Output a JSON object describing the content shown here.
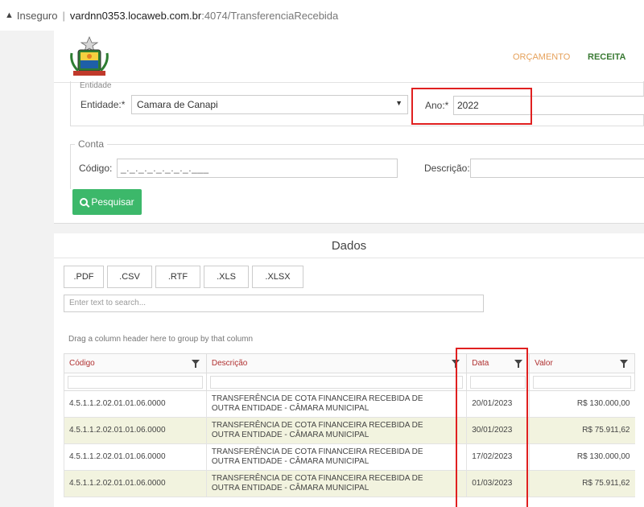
{
  "browser": {
    "security_label": "Inseguro",
    "url_host": "vardnn0353.locaweb.com.br",
    "url_path": ":4074/TransferenciaRecebida"
  },
  "header": {
    "nav": [
      {
        "label": "ORÇAMENTO"
      },
      {
        "label": "RECEITA"
      }
    ]
  },
  "filters": {
    "entidade_legend": "Entidade",
    "entidade_label": "Entidade:*",
    "entidade_value": "Camara de Canapi",
    "ano_label": "Ano:*",
    "ano_value": "2022",
    "conta_legend": "Conta",
    "codigo_label": "Código:",
    "codigo_mask": "_._._._._._._._.___",
    "descricao_label": "Descrição:",
    "search_button": "Pesquisar"
  },
  "data_panel": {
    "title": "Dados",
    "export_buttons": [
      ".PDF",
      ".CSV",
      ".RTF",
      ".XLS",
      ".XLSX"
    ],
    "search_placeholder": "Enter text to search...",
    "group_hint": "Drag a column header here to group by that column",
    "columns": [
      "Código",
      "Descrição",
      "Data",
      "Valor"
    ],
    "rows": [
      {
        "codigo": "4.5.1.1.2.02.01.01.06.0000",
        "descricao_1": "TRANSFERÊNCIA DE COTA FINANCEIRA RECEBIDA DE",
        "descricao_2": "OUTRA ENTIDADE - CÂMARA MUNICIPAL",
        "data": "20/01/2023",
        "valor": "R$ 130.000,00"
      },
      {
        "codigo": "4.5.1.1.2.02.01.01.06.0000",
        "descricao_1": "TRANSFERÊNCIA DE COTA FINANCEIRA RECEBIDA DE",
        "descricao_2": "OUTRA ENTIDADE - CÂMARA MUNICIPAL",
        "data": "30/01/2023",
        "valor": "R$ 75.911,62"
      },
      {
        "codigo": "4.5.1.1.2.02.01.01.06.0000",
        "descricao_1": "TRANSFERÊNCIA DE COTA FINANCEIRA RECEBIDA DE",
        "descricao_2": "OUTRA ENTIDADE - CÂMARA MUNICIPAL",
        "data": "17/02/2023",
        "valor": "R$ 130.000,00"
      },
      {
        "codigo": "4.5.1.1.2.02.01.01.06.0000",
        "descricao_1": "TRANSFERÊNCIA DE COTA FINANCEIRA RECEBIDA DE",
        "descricao_2": "OUTRA ENTIDADE - CÂMARA MUNICIPAL",
        "data": "01/03/2023",
        "valor": "R$ 75.911,62"
      }
    ]
  },
  "colors": {
    "accent_green": "#3cb86a",
    "highlight_red": "#e02020",
    "header_red": "#b03030",
    "row_alt": "#f2f3df"
  }
}
